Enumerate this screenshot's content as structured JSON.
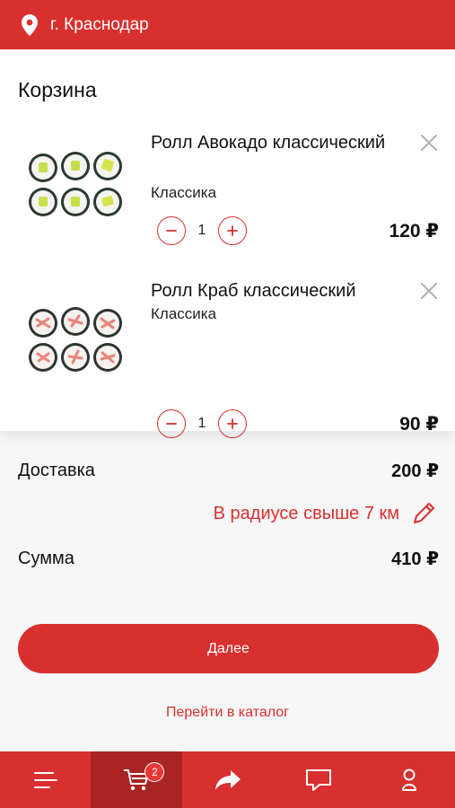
{
  "header": {
    "city": "г. Краснодар",
    "icon": "location-pin-icon"
  },
  "cart": {
    "title": "Корзина",
    "items": [
      {
        "name": "Ролл Авокадо классический",
        "category": "Классика",
        "quantity": "1",
        "price": "120 ₽"
      },
      {
        "name": "Ролл Краб классический",
        "category": "Классика",
        "quantity": "1",
        "price": "90 ₽"
      }
    ]
  },
  "summary": {
    "delivery_label": "Доставка",
    "delivery_value": "200 ₽",
    "radius_text": "В радиусе свыше 7 км",
    "sum_label": "Сумма",
    "sum_value": "410 ₽"
  },
  "actions": {
    "next_label": "Далее",
    "catalog_label": "Перейти в каталог"
  },
  "bottom_nav": {
    "items": [
      "menu-icon",
      "cart-icon",
      "share-icon",
      "chat-icon",
      "profile-icon"
    ],
    "cart_badge": "2"
  },
  "colors": {
    "brand": "#d8302e",
    "nav_active": "#a82523",
    "badge": "#e53935"
  }
}
